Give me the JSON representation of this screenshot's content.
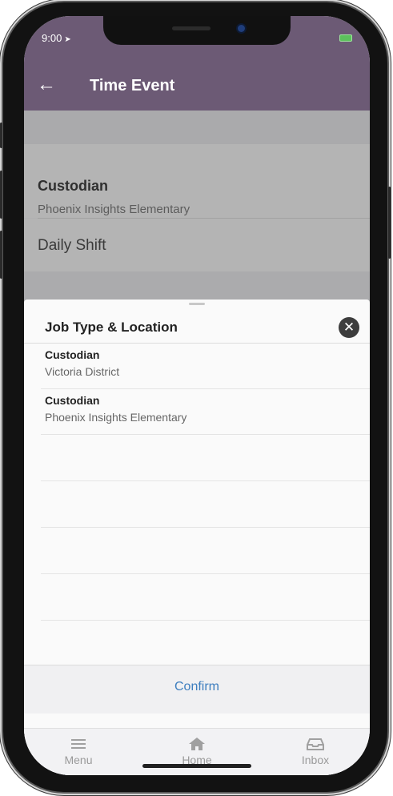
{
  "status_bar": {
    "time": "9:00",
    "location_arrow": "➤"
  },
  "app_bar": {
    "back_icon": "←",
    "title": "Time Event"
  },
  "background_form": {
    "job_title": "Custodian",
    "job_location": "Phoenix Insights Elementary",
    "shift": "Daily Shift"
  },
  "sheet": {
    "title": "Job Type & Location",
    "close_icon": "✕",
    "options": [
      {
        "job": "Custodian",
        "location": "Victoria District"
      },
      {
        "job": "Custodian",
        "location": "Phoenix Insights Elementary"
      }
    ],
    "confirm_label": "Confirm"
  },
  "tabbar": {
    "menu": "Menu",
    "home": "Home",
    "inbox": "Inbox"
  },
  "colors": {
    "primary": "#6c5a75",
    "link": "#3d7ebf"
  }
}
